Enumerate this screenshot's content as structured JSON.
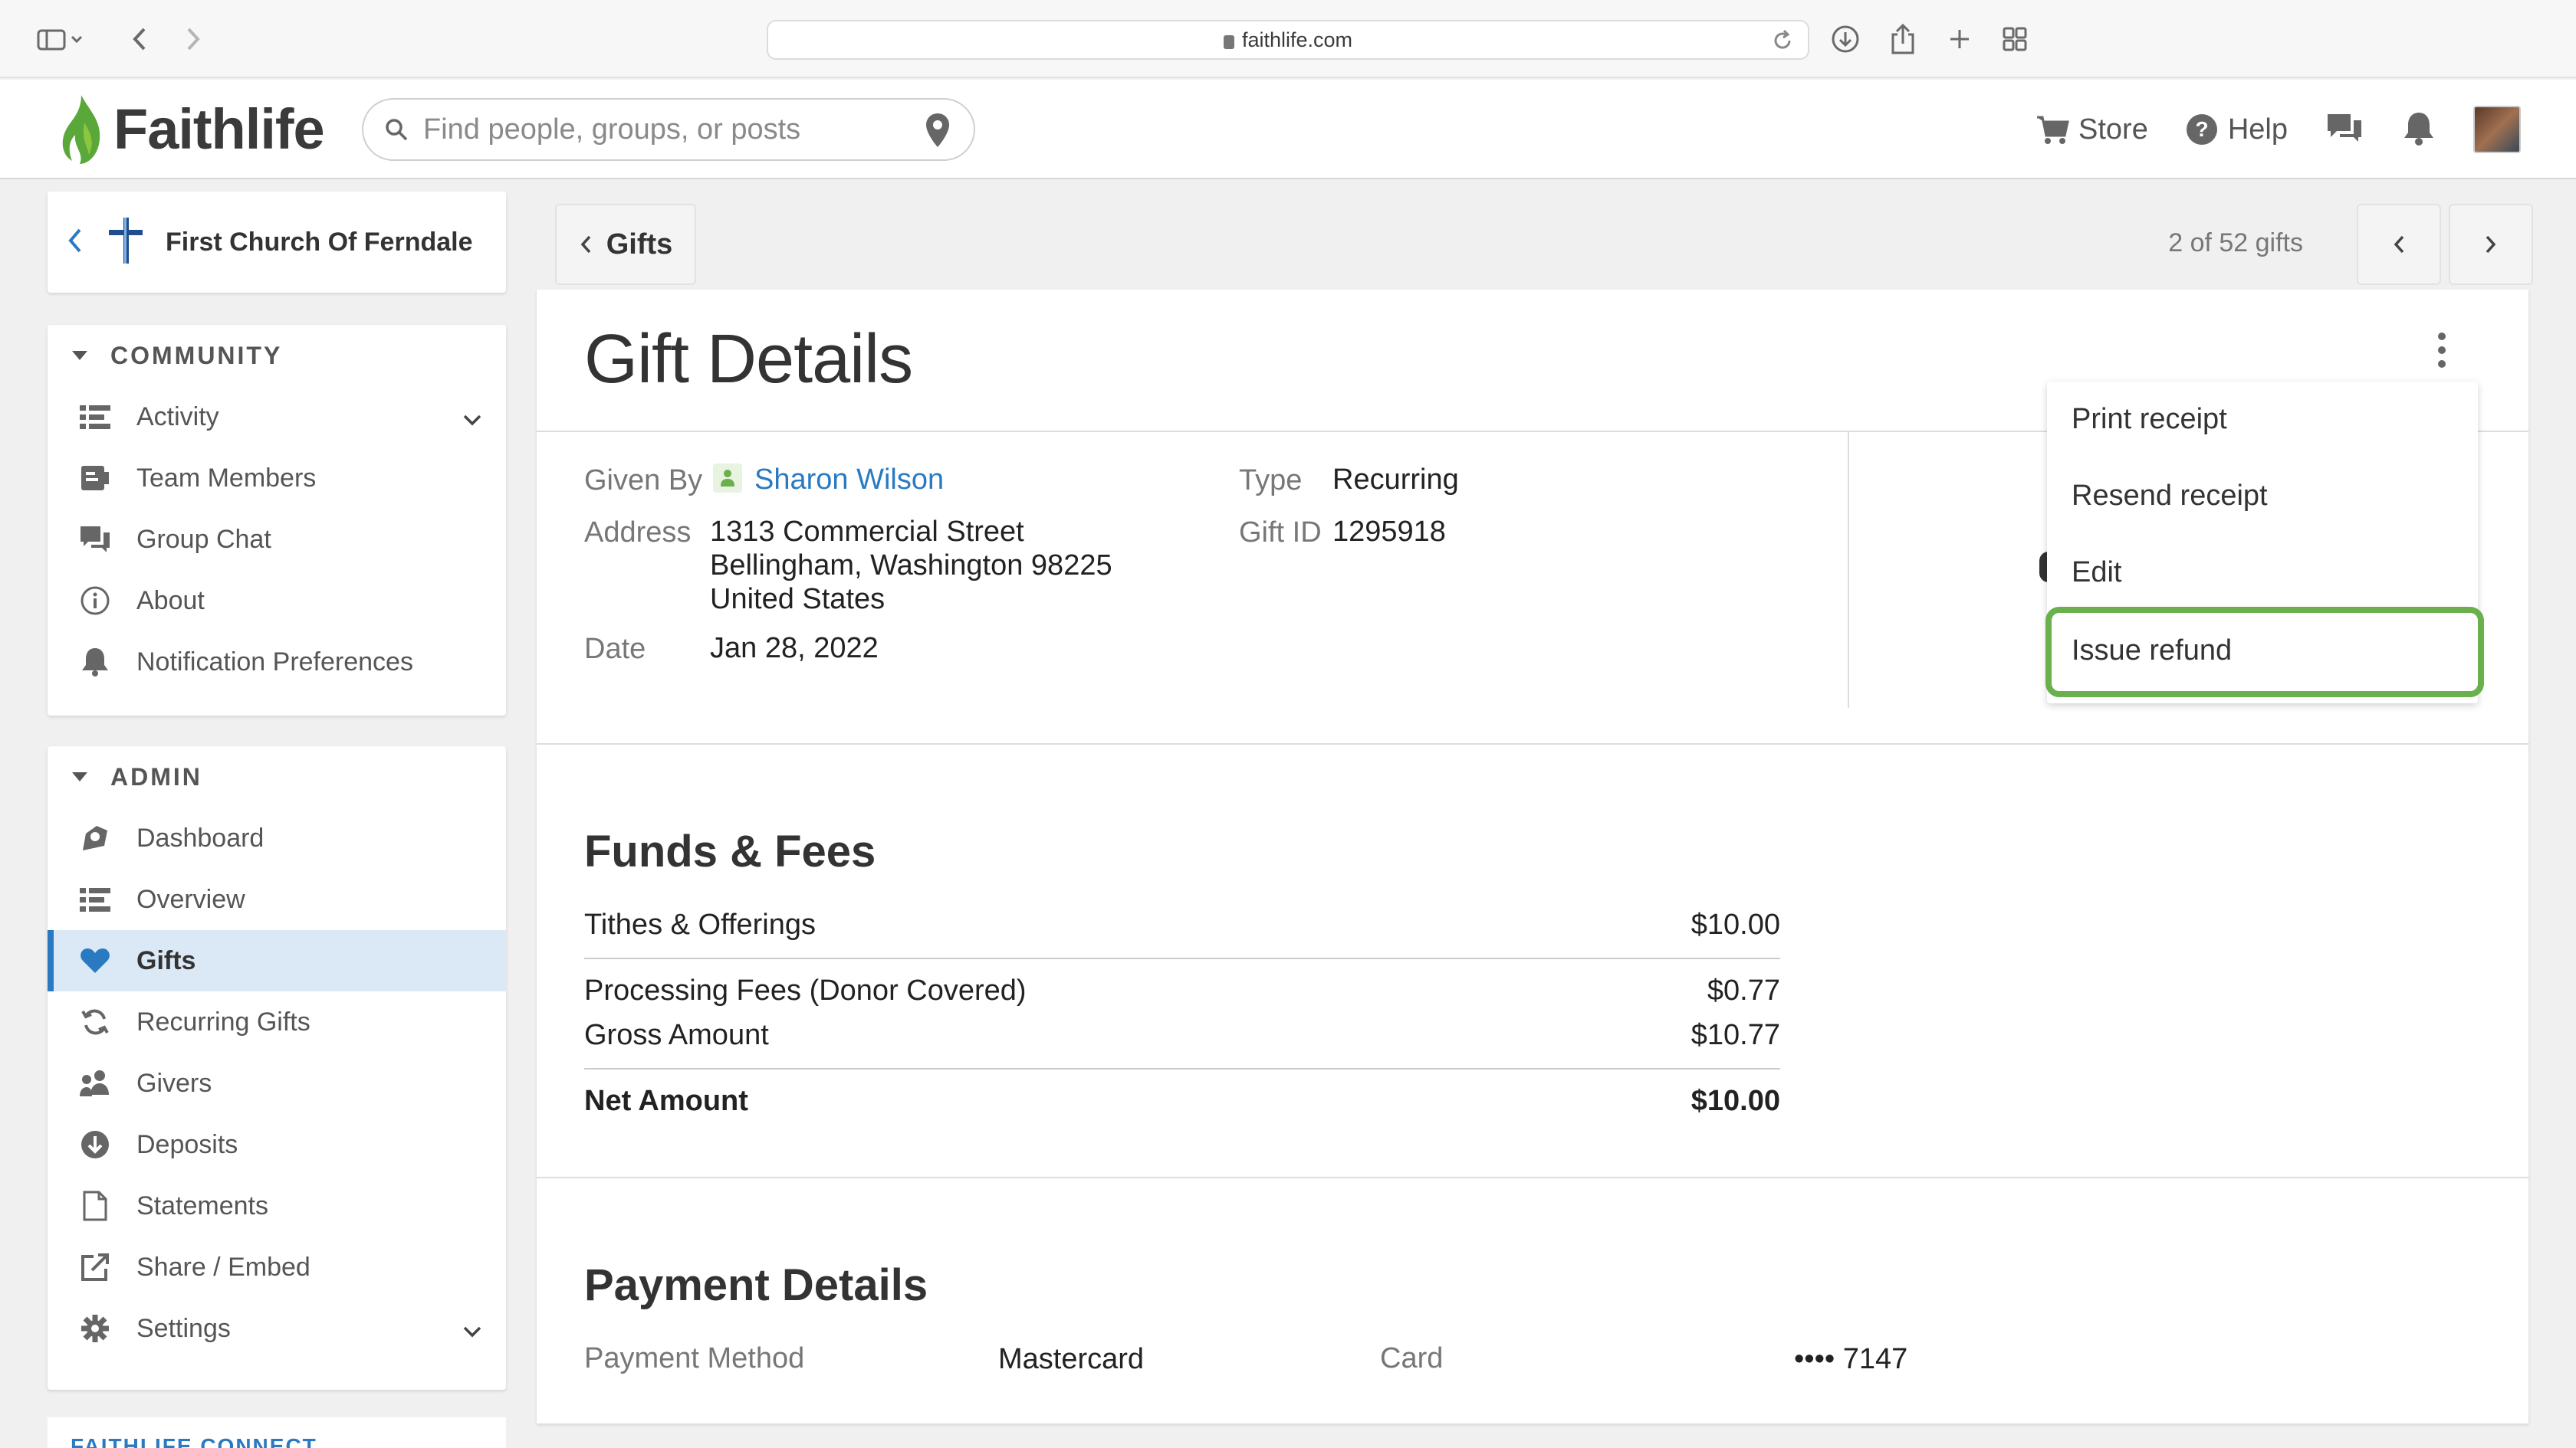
{
  "browser": {
    "url": "faithlife.com"
  },
  "header": {
    "logo_text": "Faithlife",
    "search_placeholder": "Find people, groups, or posts",
    "store_label": "Store",
    "help_label": "Help"
  },
  "sidebar": {
    "church_name": "First Church Of Ferndale",
    "community": {
      "heading": "COMMUNITY",
      "items": [
        {
          "label": "Activity",
          "icon": "list-icon"
        },
        {
          "label": "Team Members",
          "icon": "id-card-icon"
        },
        {
          "label": "Group Chat",
          "icon": "chat-icon"
        },
        {
          "label": "About",
          "icon": "info-icon"
        },
        {
          "label": "Notification Preferences",
          "icon": "bell-icon"
        }
      ]
    },
    "admin": {
      "heading": "ADMIN",
      "items": [
        {
          "label": "Dashboard",
          "icon": "dashboard-icon"
        },
        {
          "label": "Overview",
          "icon": "list-icon"
        },
        {
          "label": "Gifts",
          "icon": "heart-icon"
        },
        {
          "label": "Recurring Gifts",
          "icon": "recurring-icon"
        },
        {
          "label": "Givers",
          "icon": "people-icon"
        },
        {
          "label": "Deposits",
          "icon": "download-circle-icon"
        },
        {
          "label": "Statements",
          "icon": "document-icon"
        },
        {
          "label": "Share / Embed",
          "icon": "share-icon"
        },
        {
          "label": "Settings",
          "icon": "gear-icon"
        }
      ]
    },
    "faithlife_connect": "FAITHLIFE CONNECT"
  },
  "gift_nav": {
    "back_label": "Gifts",
    "count": "2 of 52 gifts"
  },
  "gift": {
    "title": "Gift Details",
    "given_by_label": "Given By",
    "given_by": "Sharon Wilson",
    "address_label": "Address",
    "address_line1": "1313 Commercial Street",
    "address_line2": "Bellingham, Washington 98225",
    "address_line3": "United States",
    "date_label": "Date",
    "date": "Jan 28, 2022",
    "type_label": "Type",
    "type": "Recurring",
    "gift_id_label": "Gift ID",
    "gift_id": "1295918"
  },
  "funds": {
    "heading": "Funds & Fees",
    "rows": [
      {
        "label": "Tithes & Offerings",
        "value": "$10.00"
      },
      {
        "label": "Processing Fees (Donor Covered)",
        "value": "$0.77"
      },
      {
        "label": "Gross Amount",
        "value": "$10.77"
      },
      {
        "label": "Net Amount",
        "value": "$10.00"
      }
    ]
  },
  "payment": {
    "heading": "Payment Details",
    "method_label": "Payment Method",
    "method": "Mastercard",
    "card_label": "Card",
    "card": "•••• 7147"
  },
  "menu": {
    "items": [
      "Print receipt",
      "Resend receipt",
      "Edit",
      "Issue refund"
    ]
  },
  "colors": {
    "accent": "#2a7ac2",
    "highlight": "#6ab04c",
    "logo_green": "#5aa83a"
  }
}
